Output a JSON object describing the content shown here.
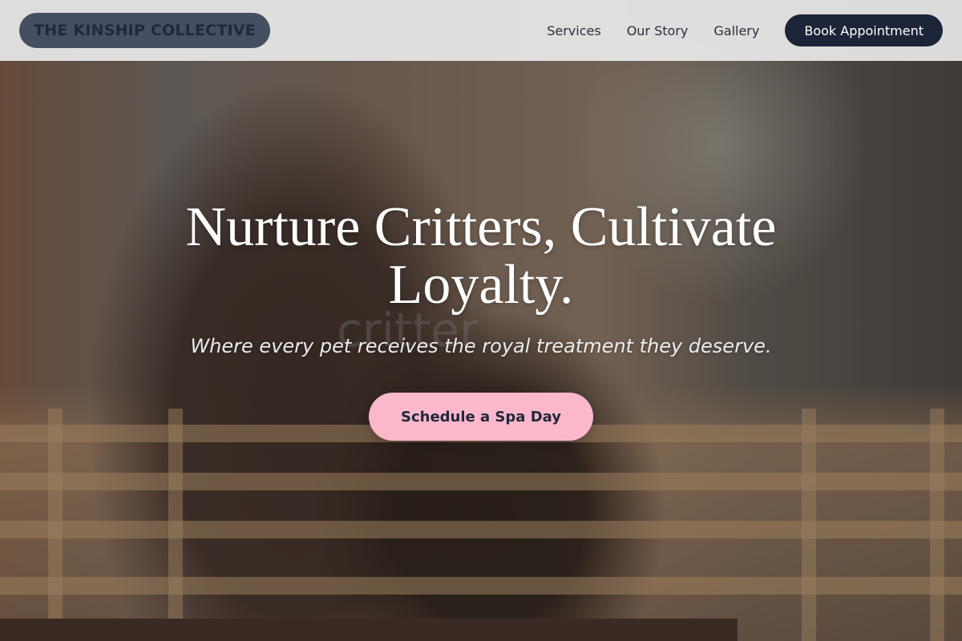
{
  "brand": {
    "logo_text": "THE KINSHIP COLLECTIVE"
  },
  "nav": {
    "links": [
      {
        "label": "Services"
      },
      {
        "label": "Our Story"
      },
      {
        "label": "Gallery"
      }
    ],
    "cta_label": "Book Appointment"
  },
  "hero": {
    "title": "Nurture Critters, Cultivate Loyalty.",
    "watermark": "critter",
    "subtitle": "Where every pet receives the royal treatment they deserve.",
    "cta_label": "Schedule a Spa Day"
  },
  "colors": {
    "nav_cta_bg": "#1c2438",
    "hero_cta_bg": "#fbb8cb",
    "logo_bg": "#454f62"
  }
}
